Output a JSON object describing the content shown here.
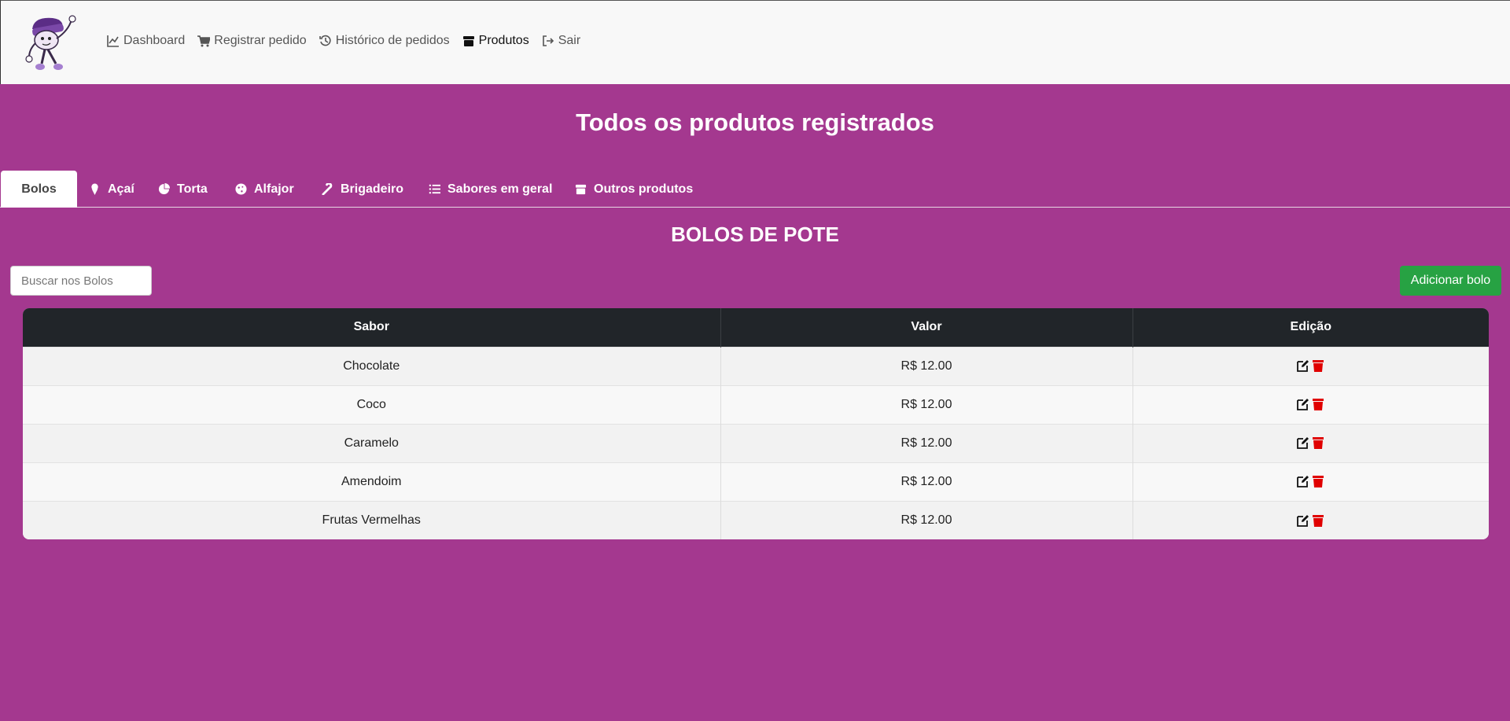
{
  "nav": {
    "links": [
      {
        "label": "Dashboard",
        "icon": "chart-line-icon"
      },
      {
        "label": "Registrar pedido",
        "icon": "cart-icon"
      },
      {
        "label": "Histórico de pedidos",
        "icon": "history-icon"
      },
      {
        "label": "Produtos",
        "icon": "box-icon",
        "active": true
      },
      {
        "label": "Sair",
        "icon": "sign-out-icon"
      }
    ]
  },
  "page": {
    "title": "Todos os produtos registrados"
  },
  "tabs": [
    {
      "label": "Bolos",
      "icon": "",
      "active": true
    },
    {
      "label": "Açaí",
      "icon": "ice-cream-icon"
    },
    {
      "label": "Torta",
      "icon": "pie-chart-icon"
    },
    {
      "label": "Alfajor",
      "icon": "cookie-icon"
    },
    {
      "label": "Brigadeiro",
      "icon": "candy-cane-icon"
    },
    {
      "label": "Sabores em geral",
      "icon": "list-icon"
    },
    {
      "label": "Outros produtos",
      "icon": "box-icon"
    }
  ],
  "section": {
    "title": "BOLOS DE POTE",
    "search_placeholder": "Buscar nos Bolos",
    "add_label": "Adicionar bolo"
  },
  "table": {
    "headers": [
      "Sabor",
      "Valor",
      "Edição"
    ],
    "rows": [
      {
        "sabor": "Chocolate",
        "valor": "R$ 12.00"
      },
      {
        "sabor": "Coco",
        "valor": "R$ 12.00"
      },
      {
        "sabor": "Caramelo",
        "valor": "R$ 12.00"
      },
      {
        "sabor": "Amendoim",
        "valor": "R$ 12.00"
      },
      {
        "sabor": "Frutas Vermelhas",
        "valor": "R$ 12.00"
      }
    ]
  },
  "colors": {
    "background": "#a4388f",
    "navbar": "#f8f8f8",
    "add_button": "#27a243",
    "table_header": "#212529",
    "delete_icon": "#e00000"
  }
}
